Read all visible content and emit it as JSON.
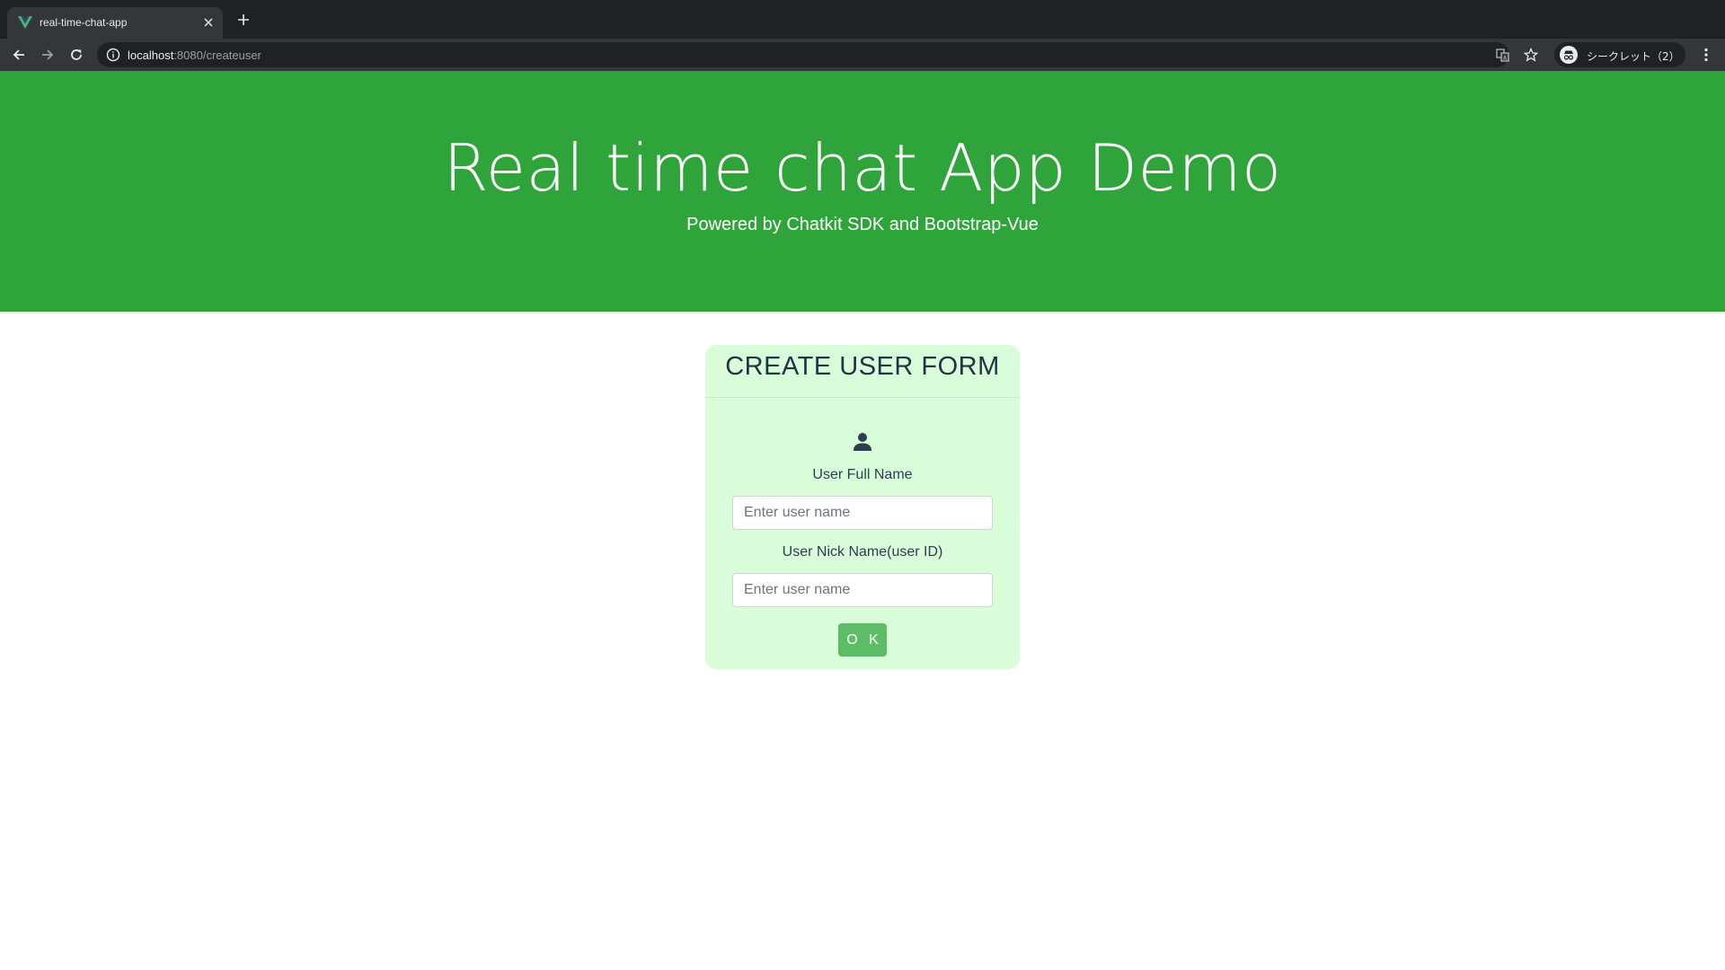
{
  "browser": {
    "tab": {
      "title": "real-time-chat-app"
    },
    "address": {
      "host": "localhost",
      "rest": ":8080/createuser"
    },
    "profile": {
      "label": "シークレット（2）"
    },
    "icons": {
      "favicon": "vue-logo-icon",
      "close": "close-icon",
      "new_tab": "plus-icon",
      "back": "arrow-left-icon",
      "forward": "arrow-right-icon",
      "reload": "reload-icon",
      "info": "info-icon",
      "translate": "translate-icon",
      "bookmark": "star-icon",
      "incognito": "incognito-icon",
      "menu": "more-vert-icon"
    }
  },
  "hero": {
    "title": "Real time chat App Demo",
    "subtitle": "Powered by Chatkit SDK and Bootstrap-Vue",
    "background_color": "#2ea43a"
  },
  "form": {
    "title": "CREATE USER FORM",
    "icon": "user-icon",
    "full_name": {
      "label": "User Full Name",
      "placeholder": "Enter user name",
      "value": ""
    },
    "nick_name": {
      "label": "User Nick Name(user ID)",
      "placeholder": "Enter user name",
      "value": ""
    },
    "submit_label": "O K",
    "card_color": "#dafdd9",
    "button_color": "#5cbd66"
  }
}
